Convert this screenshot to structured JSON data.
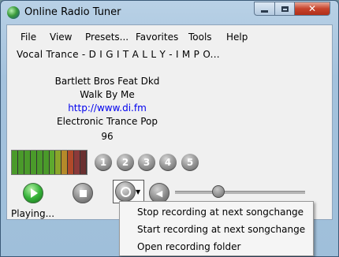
{
  "window": {
    "title": "Online Radio Tuner"
  },
  "menu": [
    "File",
    "View",
    "Presets...",
    "Favorites",
    "Tools",
    "Help"
  ],
  "station": {
    "now_playing_title": "Vocal Trance - D I G I T A L L Y - I M P O..."
  },
  "track": {
    "artist": "Bartlett Bros Feat Dkd",
    "title": "Walk By Me",
    "url": "http://www.di.fm",
    "genre": "Electronic Trance Pop",
    "bitrate": "96"
  },
  "presets": [
    "1",
    "2",
    "3",
    "4",
    "5"
  ],
  "status": {
    "text": "Playing..."
  },
  "context_menu": {
    "items": [
      "Stop recording at next songchange",
      "Start recording at next songchange",
      "Open recording folder"
    ]
  },
  "vu_meter": {
    "colors": [
      "#4a9a2a",
      "#4a9a2a",
      "#4a9a2a",
      "#4a9a2a",
      "#4a9a2a",
      "#4a9a2a",
      "#5ea92e",
      "#8aa52a",
      "#b58a2a",
      "#b04a2a",
      "#8b3a3a",
      "#6a3030"
    ]
  },
  "volume": {
    "level": 0.33
  }
}
